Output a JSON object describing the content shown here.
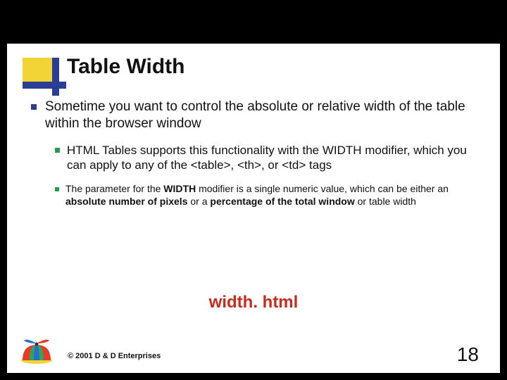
{
  "title": "Table Width",
  "bullets": {
    "level1": "Sometime you want to control the absolute or relative width of the table within the browser window",
    "level2": "HTML Tables supports this functionality with the WIDTH modifier, which you can apply to any of the <table>, <th>, or <td> tags",
    "level3_parts": {
      "a": "The parameter for the ",
      "b": "WIDTH",
      "c": " modifier is a single numeric value, which can be either an ",
      "d": "absolute number of pixels",
      "e": " or a ",
      "f": "percentage of the total window",
      "g": " or table width"
    }
  },
  "link_text": "width. html",
  "copyright": "© 2001 D & D Enterprises",
  "page_number": "18"
}
